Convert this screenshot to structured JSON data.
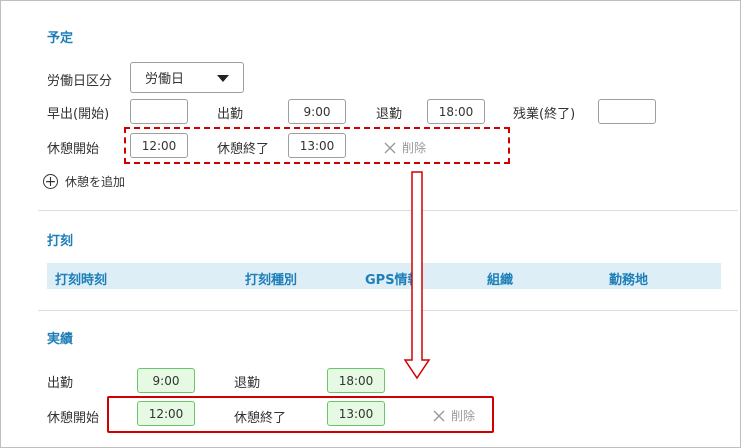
{
  "schedule": {
    "title": "予定",
    "workday_type_label": "労働日区分",
    "workday_type_value": "労働日",
    "early_start_label": "早出(開始)",
    "early_start_value": "",
    "clock_in_label": "出勤",
    "clock_in_value": "9:00",
    "clock_out_label": "退勤",
    "clock_out_value": "18:00",
    "overtime_end_label": "残業(終了)",
    "overtime_end_value": "",
    "break_start_label": "休憩開始",
    "break_start_value": "12:00",
    "break_end_label": "休憩終了",
    "break_end_value": "13:00",
    "delete_label": "削除",
    "add_break_label": "休憩を追加"
  },
  "stamping": {
    "title": "打刻",
    "columns": [
      "打刻時刻",
      "打刻種別",
      "GPS情報",
      "組織",
      "勤務地"
    ]
  },
  "actual": {
    "title": "実績",
    "clock_in_label": "出勤",
    "clock_in_value": "9:00",
    "clock_out_label": "退勤",
    "clock_out_value": "18:00",
    "break_start_label": "休憩開始",
    "break_start_value": "12:00",
    "break_end_label": "休憩終了",
    "break_end_value": "13:00",
    "delete_label": "削除"
  },
  "annotation": {
    "highlight_color": "#d10000"
  }
}
